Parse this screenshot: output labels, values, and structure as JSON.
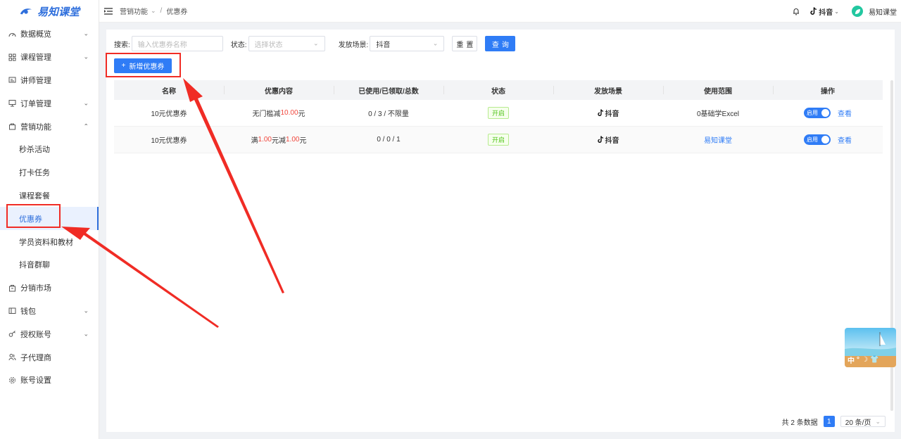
{
  "brand": {
    "name": "易知课堂"
  },
  "sidebar": {
    "items": [
      {
        "label": "数据概览",
        "icon": "dashboard-icon",
        "chevron": "down"
      },
      {
        "label": "课程管理",
        "icon": "grid-icon",
        "chevron": "down"
      },
      {
        "label": "讲师管理",
        "icon": "id-card-icon",
        "chevron": ""
      },
      {
        "label": "订单管理",
        "icon": "monitor-icon",
        "chevron": "down"
      },
      {
        "label": "营销功能",
        "icon": "bag-icon",
        "chevron": "up"
      },
      {
        "label": "秒杀活动"
      },
      {
        "label": "打卡任务"
      },
      {
        "label": "课程套餐"
      },
      {
        "label": "优惠券"
      },
      {
        "label": "学员资料和教材"
      },
      {
        "label": "抖音群聊"
      },
      {
        "label": "分销市场",
        "icon": "shop-icon",
        "chevron": ""
      },
      {
        "label": "钱包",
        "icon": "wallet-icon",
        "chevron": "down"
      },
      {
        "label": "授权账号",
        "icon": "key-icon",
        "chevron": "down"
      },
      {
        "label": "子代理商",
        "icon": "users-icon",
        "chevron": ""
      },
      {
        "label": "账号设置",
        "icon": "gear-icon",
        "chevron": ""
      }
    ]
  },
  "header": {
    "breadcrumb": {
      "parent": "营销功能",
      "separator": "/",
      "current": "优惠券"
    },
    "platform": "抖音",
    "user": "易知课堂"
  },
  "filters": {
    "search_label": "搜索:",
    "search_placeholder": "输入优惠券名称",
    "status_label": "状态:",
    "status_placeholder": "选择状态",
    "scene_label": "发放场景:",
    "scene_value": "抖音",
    "reset_label": "重置",
    "query_label": "查询"
  },
  "add_button": {
    "label": "新增优惠券"
  },
  "table": {
    "columns": [
      "名称",
      "优惠内容",
      "已使用/已领取/总数",
      "状态",
      "发放场景",
      "使用范围",
      "操作"
    ],
    "rows": [
      {
        "name": "10元优惠券",
        "content_prefix": "无门槛减",
        "content_amount": "10.00",
        "content_suffix": "元",
        "usage": "0 / 3 / 不限量",
        "status": "开启",
        "scene": "抖音",
        "scope": "0基础学Excel",
        "switch_label": "启用",
        "view_label": "查看"
      },
      {
        "name": "10元优惠券",
        "content_prefix": "满",
        "content_amount": "1.00",
        "content_mid": "元减",
        "content_amount2": "1.00",
        "content_suffix": "元",
        "usage": "0 / 0 / 1",
        "status": "开启",
        "scene": "抖音",
        "scope": "易知课堂",
        "switch_label": "启用",
        "view_label": "查看"
      }
    ]
  },
  "pagination": {
    "total_text": "共 2 条数据",
    "current_page": "1",
    "page_size": "20 条/页"
  },
  "widget": {
    "chars": [
      "中",
      "°"
    ]
  },
  "colors": {
    "primary": "#2f7cf6",
    "danger": "#f0473d",
    "annotation": "#f02c25",
    "success": "#52c41a"
  }
}
